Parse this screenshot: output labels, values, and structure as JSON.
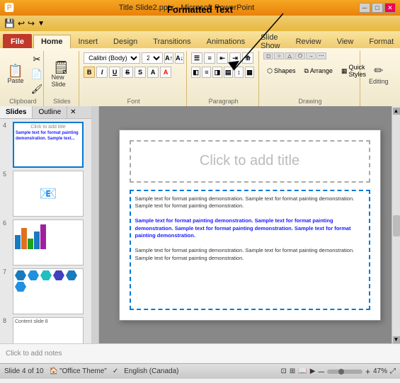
{
  "window": {
    "title": "Title Slide2.pptx - Microsoft PowerPoint",
    "formatted_text_label": "Formatted Text"
  },
  "ribbon": {
    "tabs": [
      "File",
      "Home",
      "Insert",
      "Design",
      "Transitions",
      "Animations",
      "Slide Show",
      "Review",
      "View",
      "Format"
    ],
    "active_tab": "Home",
    "groups": {
      "clipboard": "Clipboard",
      "slides": "Slides",
      "font": "Font",
      "paragraph": "Paragraph",
      "drawing": "Drawing"
    },
    "font_name": "Calibri (Body)",
    "font_size": "20",
    "editing_label": "Editing"
  },
  "slides_panel": {
    "tabs": [
      "Slides",
      "Outline"
    ],
    "slide_count": 10,
    "current_slide": 4
  },
  "slide": {
    "title_placeholder": "Click to add title",
    "paragraph1": "Sample text for format painting demonstration. Sample text for format painting demonstration. Sample text for format painting demonstration.",
    "paragraph2_bold": "Sample text for format painting demonstration. Sample text for format painting demonstration. Sample text for format painting demonstration. Sample text for format painting demonstration.",
    "paragraph3": "Sample text for format painting demonstration. Sample text for format painting demonstration. Sample text for format painting demonstration."
  },
  "notes": {
    "placeholder": "Click to add notes"
  },
  "status": {
    "slide_info": "Slide 4 of 10",
    "theme": "\"Office Theme\"",
    "language": "English (Canada)",
    "zoom": "47%",
    "office_label": "Office"
  },
  "buttons": {
    "paste": "Paste",
    "new_slide": "New Slide",
    "shapes": "Shapes",
    "arrange": "Arrange",
    "quick_styles": "Quick Styles",
    "bold": "B",
    "italic": "I",
    "underline": "U",
    "strikethrough": "S",
    "close": "✕",
    "minimize": "─",
    "maximize": "□"
  }
}
